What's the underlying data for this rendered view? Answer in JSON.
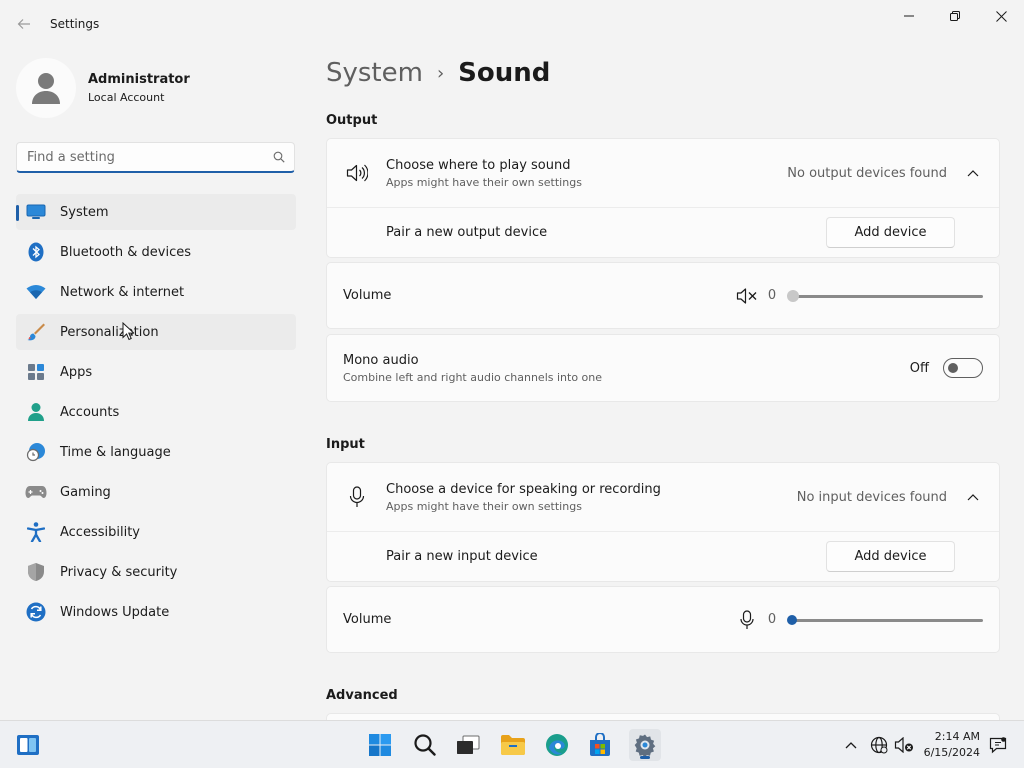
{
  "window": {
    "title": "Settings",
    "controls": [
      "minimize-icon",
      "restore-icon",
      "close-icon"
    ]
  },
  "profile": {
    "name": "Administrator",
    "account_type": "Local Account"
  },
  "search": {
    "placeholder": "Find a setting"
  },
  "sidebar": {
    "items": [
      {
        "label": "System",
        "icon": "system-icon",
        "active": true
      },
      {
        "label": "Bluetooth & devices",
        "icon": "bluetooth-icon"
      },
      {
        "label": "Network & internet",
        "icon": "wifi-icon"
      },
      {
        "label": "Personalization",
        "icon": "brush-icon"
      },
      {
        "label": "Apps",
        "icon": "apps-icon"
      },
      {
        "label": "Accounts",
        "icon": "accounts-icon"
      },
      {
        "label": "Time & language",
        "icon": "clock-globe-icon"
      },
      {
        "label": "Gaming",
        "icon": "gamepad-icon"
      },
      {
        "label": "Accessibility",
        "icon": "accessibility-icon"
      },
      {
        "label": "Privacy & security",
        "icon": "shield-icon"
      },
      {
        "label": "Windows Update",
        "icon": "update-icon"
      }
    ]
  },
  "breadcrumb": {
    "parent": "System",
    "separator": "›",
    "current": "Sound"
  },
  "output": {
    "heading": "Output",
    "choose_title": "Choose where to play sound",
    "choose_sub": "Apps might have their own settings",
    "choose_status": "No output devices found",
    "pair_label": "Pair a new output device",
    "add_button": "Add device",
    "volume_label": "Volume",
    "volume_value": "0",
    "mono_title": "Mono audio",
    "mono_sub": "Combine left and right audio channels into one",
    "mono_state": "Off"
  },
  "input": {
    "heading": "Input",
    "choose_title": "Choose a device for speaking or recording",
    "choose_sub": "Apps might have their own settings",
    "choose_status": "No input devices found",
    "pair_label": "Pair a new input device",
    "add_button": "Add device",
    "volume_label": "Volume",
    "volume_value": "0"
  },
  "advanced": {
    "heading": "Advanced"
  },
  "taskbar": {
    "apps": [
      "widgets-icon",
      "start-icon",
      "search-icon",
      "task-view-icon",
      "file-explorer-icon",
      "edge-icon",
      "store-icon",
      "settings-icon"
    ],
    "time": "2:14 AM",
    "date": "6/15/2024"
  },
  "colors": {
    "accent": "#1f5fa8",
    "background": "#f3f3f3",
    "card": "#fbfbfb"
  }
}
